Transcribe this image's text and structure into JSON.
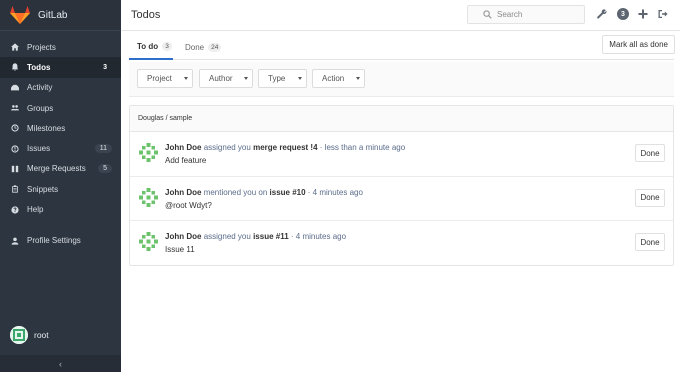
{
  "app": {
    "brand": "GitLab"
  },
  "colors": {
    "sidebar": "#2d3540",
    "accent": "#2e6fcc",
    "link": "#5b6c8a",
    "logo": "#e2432a"
  },
  "sidebar": {
    "items": [
      {
        "label": "Projects",
        "icon": "home-icon"
      },
      {
        "label": "Todos",
        "icon": "bell-icon",
        "count": "3"
      },
      {
        "label": "Activity",
        "icon": "dashboard-icon"
      },
      {
        "label": "Groups",
        "icon": "group-icon"
      },
      {
        "label": "Milestones",
        "icon": "clock-icon"
      },
      {
        "label": "Issues",
        "icon": "exclamation-circle-icon",
        "count": "11"
      },
      {
        "label": "Merge Requests",
        "icon": "merge-icon",
        "count": "5"
      },
      {
        "label": "Snippets",
        "icon": "clipboard-icon"
      },
      {
        "label": "Help",
        "icon": "question-circle-icon"
      }
    ],
    "profile": {
      "label": "Profile Settings",
      "icon": "user-icon"
    },
    "user": {
      "name": "root"
    },
    "collapse_label": "‹"
  },
  "header": {
    "title": "Todos",
    "search_placeholder": "Search",
    "todo_count": "3"
  },
  "tabs": [
    {
      "label": "To do",
      "count": "3",
      "active": true
    },
    {
      "label": "Done",
      "count": "24",
      "active": false
    }
  ],
  "mark_all_label": "Mark all as done",
  "filters": {
    "project": "Project",
    "author": "Author",
    "type": "Type",
    "action": "Action"
  },
  "group_header": "Douglas / sample",
  "todos": [
    {
      "author": "John Doe",
      "action": "assigned you",
      "target": "merge request !4",
      "time": "· less than a minute ago",
      "body": "Add feature",
      "done_label": "Done"
    },
    {
      "author": "John Doe",
      "action": "mentioned you on",
      "target": "issue #10",
      "time": "· 4 minutes ago",
      "body": "@root Wdyt?",
      "done_label": "Done"
    },
    {
      "author": "John Doe",
      "action": "assigned you",
      "target": "issue #11",
      "time": "· 4 minutes ago",
      "body": "Issue 11",
      "done_label": "Done"
    }
  ]
}
